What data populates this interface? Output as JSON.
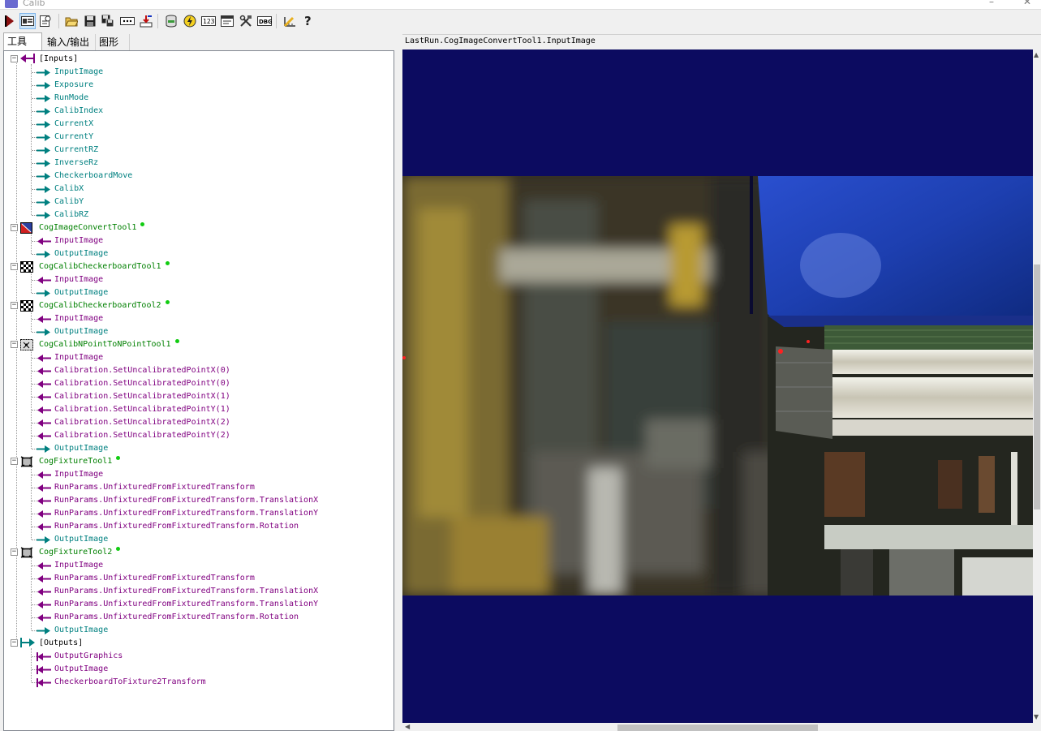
{
  "window": {
    "title": "Calib"
  },
  "toolbar": {
    "buttons": [
      {
        "name": "run-icon"
      },
      {
        "name": "image-display-icon"
      },
      {
        "name": "edit-icon"
      },
      {
        "name": "open-folder-icon"
      },
      {
        "name": "save-icon"
      },
      {
        "name": "save-as-icon"
      },
      {
        "name": "ellipsis-icon"
      },
      {
        "name": "import-icon"
      },
      {
        "name": "database-icon"
      },
      {
        "name": "lightning-icon"
      },
      {
        "name": "numeric-123-icon"
      },
      {
        "name": "terminal-icon"
      },
      {
        "name": "tools-icon"
      },
      {
        "name": "dbg-icon"
      },
      {
        "name": "ruler-icon"
      },
      {
        "name": "help-icon"
      }
    ],
    "labels": {
      "numeric": "123",
      "dbg": "DBG"
    }
  },
  "tabs": [
    {
      "label": "工具",
      "active": true
    },
    {
      "label": "输入/输出",
      "active": false
    },
    {
      "label": "图形",
      "active": false
    }
  ],
  "colors": {
    "input_terminal": "#008080",
    "output_terminal": "#800080",
    "tool_name": "#008000",
    "viewer_bg": "#0c0b60"
  },
  "tree": [
    {
      "level": 0,
      "type": "group-in",
      "label": "[Inputs]",
      "expanded": true
    },
    {
      "level": 1,
      "type": "in",
      "label": "InputImage"
    },
    {
      "level": 1,
      "type": "in",
      "label": "Exposure"
    },
    {
      "level": 1,
      "type": "in",
      "label": "RunMode"
    },
    {
      "level": 1,
      "type": "in",
      "label": "CalibIndex"
    },
    {
      "level": 1,
      "type": "in",
      "label": "CurrentX"
    },
    {
      "level": 1,
      "type": "in",
      "label": "CurrentY"
    },
    {
      "level": 1,
      "type": "in",
      "label": "CurrentRZ"
    },
    {
      "level": 1,
      "type": "in",
      "label": "InverseRz"
    },
    {
      "level": 1,
      "type": "in",
      "label": "CheckerboardMove"
    },
    {
      "level": 1,
      "type": "in",
      "label": "CalibX"
    },
    {
      "level": 1,
      "type": "in",
      "label": "CalibY"
    },
    {
      "level": 1,
      "type": "in",
      "label": "CalibRZ"
    },
    {
      "level": 0,
      "type": "tool",
      "icon": "convert",
      "label": "CogImageConvertTool1",
      "expanded": true
    },
    {
      "level": 1,
      "type": "out",
      "label": "InputImage"
    },
    {
      "level": 1,
      "type": "in",
      "label": "OutputImage"
    },
    {
      "level": 0,
      "type": "tool",
      "icon": "checker",
      "label": "CogCalibCheckerboardTool1",
      "expanded": true
    },
    {
      "level": 1,
      "type": "out",
      "label": "InputImage"
    },
    {
      "level": 1,
      "type": "in",
      "label": "OutputImage"
    },
    {
      "level": 0,
      "type": "tool",
      "icon": "checker",
      "label": "CogCalibCheckerboardTool2",
      "expanded": true
    },
    {
      "level": 1,
      "type": "out",
      "label": "InputImage"
    },
    {
      "level": 1,
      "type": "in",
      "label": "OutputImage"
    },
    {
      "level": 0,
      "type": "tool",
      "icon": "npoint",
      "label": "CogCalibNPointToNPointTool1",
      "expanded": true
    },
    {
      "level": 1,
      "type": "out",
      "label": "InputImage"
    },
    {
      "level": 1,
      "type": "out",
      "label": "Calibration.SetUncalibratedPointX(0)"
    },
    {
      "level": 1,
      "type": "out",
      "label": "Calibration.SetUncalibratedPointY(0)"
    },
    {
      "level": 1,
      "type": "out",
      "label": "Calibration.SetUncalibratedPointX(1)"
    },
    {
      "level": 1,
      "type": "out",
      "label": "Calibration.SetUncalibratedPointY(1)"
    },
    {
      "level": 1,
      "type": "out",
      "label": "Calibration.SetUncalibratedPointX(2)"
    },
    {
      "level": 1,
      "type": "out",
      "label": "Calibration.SetUncalibratedPointY(2)"
    },
    {
      "level": 1,
      "type": "in",
      "label": "OutputImage"
    },
    {
      "level": 0,
      "type": "tool",
      "icon": "fixture",
      "label": "CogFixtureTool1",
      "expanded": true
    },
    {
      "level": 1,
      "type": "out",
      "label": "InputImage"
    },
    {
      "level": 1,
      "type": "out",
      "label": "RunParams.UnfixturedFromFixturedTransform"
    },
    {
      "level": 1,
      "type": "out",
      "label": "RunParams.UnfixturedFromFixturedTransform.TranslationX"
    },
    {
      "level": 1,
      "type": "out",
      "label": "RunParams.UnfixturedFromFixturedTransform.TranslationY"
    },
    {
      "level": 1,
      "type": "out",
      "label": "RunParams.UnfixturedFromFixturedTransform.Rotation"
    },
    {
      "level": 1,
      "type": "in",
      "label": "OutputImage"
    },
    {
      "level": 0,
      "type": "tool",
      "icon": "fixture",
      "label": "CogFixtureTool2",
      "expanded": true
    },
    {
      "level": 1,
      "type": "out",
      "label": "InputImage"
    },
    {
      "level": 1,
      "type": "out",
      "label": "RunParams.UnfixturedFromFixturedTransform"
    },
    {
      "level": 1,
      "type": "out",
      "label": "RunParams.UnfixturedFromFixturedTransform.TranslationX"
    },
    {
      "level": 1,
      "type": "out",
      "label": "RunParams.UnfixturedFromFixturedTransform.TranslationY"
    },
    {
      "level": 1,
      "type": "out",
      "label": "RunParams.UnfixturedFromFixturedTransform.Rotation"
    },
    {
      "level": 1,
      "type": "in",
      "label": "OutputImage"
    },
    {
      "level": 0,
      "type": "group-out",
      "label": "[Outputs]",
      "expanded": true
    },
    {
      "level": 1,
      "type": "out-bar",
      "label": "OutputGraphics"
    },
    {
      "level": 1,
      "type": "out-bar",
      "label": "OutputImage"
    },
    {
      "level": 1,
      "type": "out-bar",
      "label": "CheckerboardToFixture2Transform"
    }
  ],
  "viewer": {
    "title": "LastRun.CogImageConvertTool1.InputImage"
  }
}
